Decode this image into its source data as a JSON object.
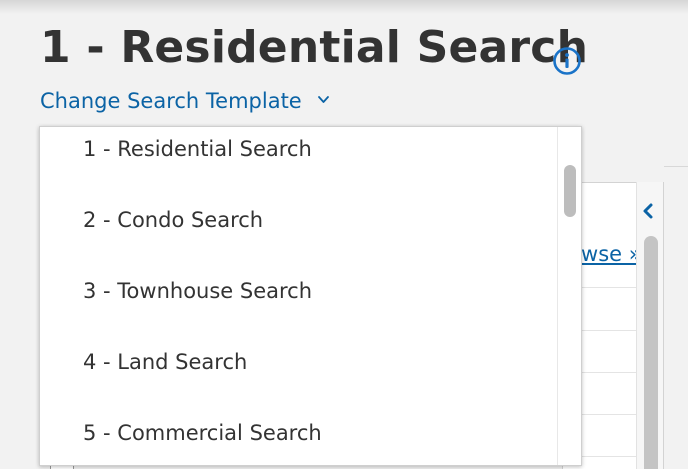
{
  "header": {
    "title": "1 - Residential Search",
    "info_icon": "info-circle-icon",
    "change_template_label": "Change Search Template",
    "chevron_icon": "chevron-down-icon"
  },
  "template_dropdown": {
    "options": [
      "1 - Residential Search",
      "2 - Condo Search",
      "3 - Townhouse Search",
      "4 - Land Search",
      "5 - Commercial Search"
    ]
  },
  "background_panel": {
    "browse_link": "rowse »",
    "collapse_icon": "chevron-left-icon"
  },
  "colors": {
    "link": "#0b63a5",
    "title": "#333333",
    "background": "#f2f2f2"
  }
}
